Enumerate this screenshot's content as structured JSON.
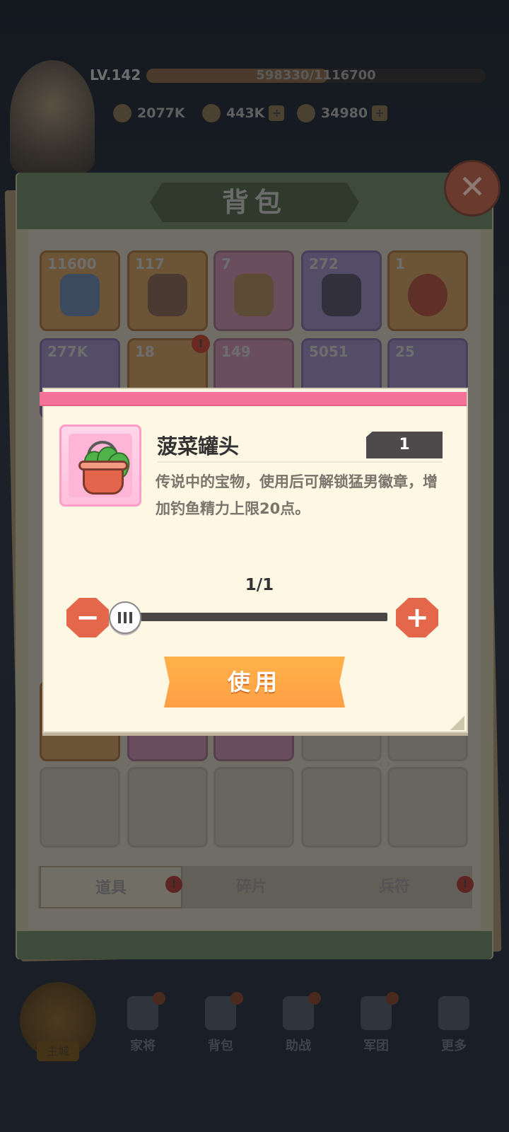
{
  "hud": {
    "level": "LV.142",
    "xp_text": "598330/1116700",
    "xp_progress": 0.536,
    "power": "2077K",
    "gold": "443K",
    "gems": "34980"
  },
  "bag": {
    "title": "背包",
    "row1_counts": [
      "11600",
      "117",
      "7",
      "272",
      "1"
    ],
    "row2_counts": [
      "277K",
      "18",
      "149",
      "5051",
      "25"
    ],
    "tabs": [
      "道具",
      "碎片",
      "兵符"
    ],
    "active_tab": "道具",
    "alert_glyph": "!"
  },
  "bottom_nav": {
    "home_label": "主城",
    "items": [
      "家将",
      "背包",
      "助战",
      "军团",
      "更多"
    ]
  },
  "dialog": {
    "item_name": "菠菜罐头",
    "item_count": "1",
    "description": "传说中的宝物，使用后可解锁猛男徽章，增加钓鱼精力上限20点。",
    "selected": "1/1",
    "selected_value": 1,
    "max_value": 1,
    "minus_glyph": "−",
    "plus_glyph": "+",
    "use_label": "使用"
  },
  "colors": {
    "accent_pink": "#f5739b",
    "button_orange": "#ff9f45",
    "stepper_red": "#e5674b"
  }
}
